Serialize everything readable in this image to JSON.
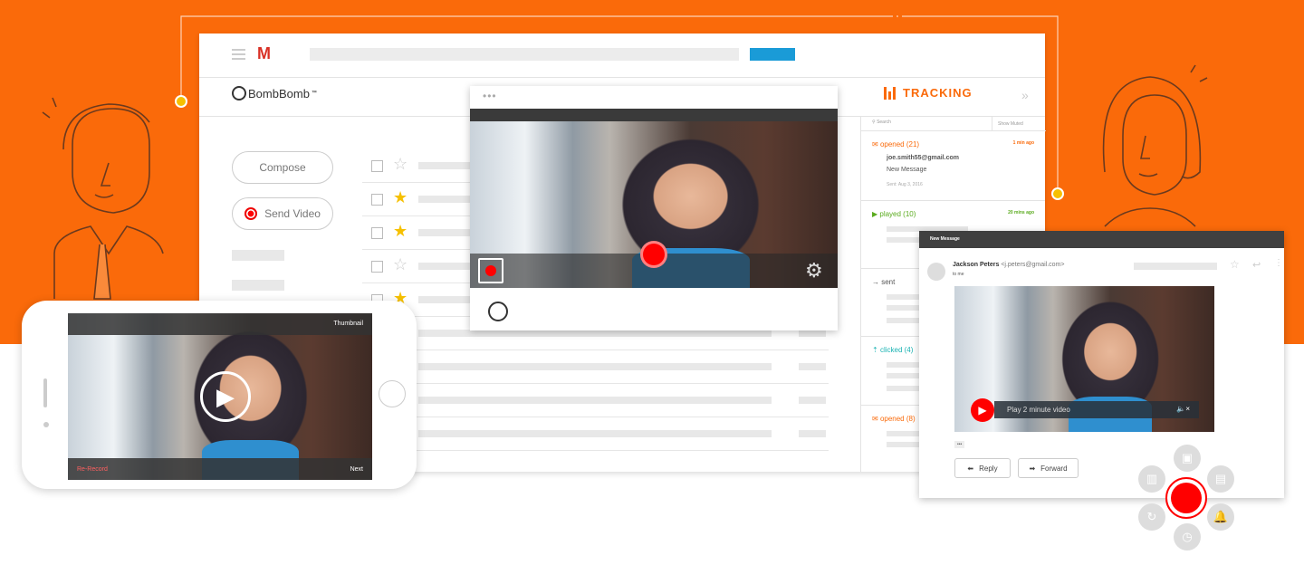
{
  "brand": {
    "name": "BombBomb",
    "trademark": "™",
    "accent": "#fa6a0a",
    "record_red": "#ff0000"
  },
  "gmail": {
    "logo": "M",
    "compose_label": "Compose",
    "send_video_label": "Send Video"
  },
  "tracking": {
    "title": "TRACKING",
    "collapse": "»",
    "search_placeholder": "Search",
    "show_muted": "Show Muted",
    "items": [
      {
        "icon": "envelope-icon",
        "label": "opened (21)",
        "ago": "1 min ago",
        "color": "#fa6a0a",
        "email": "joe.smith55@gmail.com",
        "subject": "New Message",
        "sent_label": "Sent:",
        "sent_date": "Aug 3, 2016"
      },
      {
        "icon": "play-icon",
        "label": "played (10)",
        "ago": "20 mins ago",
        "color": "#5aab1e"
      },
      {
        "icon": "arrow-icon",
        "label": "sent",
        "color": "#555"
      },
      {
        "icon": "cursor-icon",
        "label": "clicked (4)",
        "color": "#1bb3b3"
      },
      {
        "icon": "envelope-icon",
        "label": "opened (8)",
        "color": "#fa6a0a"
      }
    ]
  },
  "phone": {
    "thumbnail": "Thumbnail",
    "rerecord": "Re-Record",
    "next": "Next"
  },
  "message": {
    "title": "New Message",
    "sender": "Jackson Peters",
    "sender_email": "<j.peters@gmail.com>",
    "to": "to me",
    "play_label": "Play 2 minute video",
    "mute": "×",
    "more": "•••",
    "reply": "Reply",
    "forward": "Forward"
  }
}
